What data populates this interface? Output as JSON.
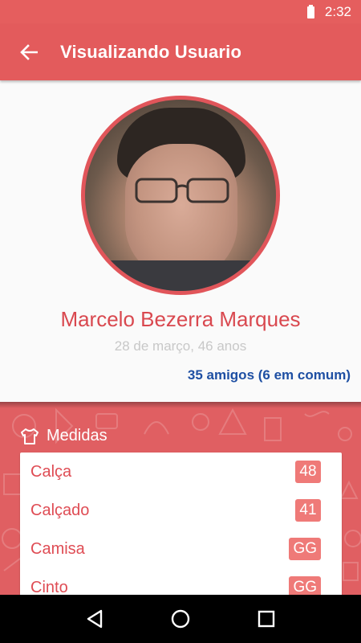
{
  "status_bar": {
    "time": "2:32",
    "battery_icon": "battery-icon"
  },
  "app_bar": {
    "title": "Visualizando Usuario",
    "back_icon": "arrow-back-icon",
    "color": "#e35b5c"
  },
  "profile": {
    "name": "Marcelo Bezerra Marques",
    "subtitle": "28 de março, 46 anos",
    "friends": "35 amigos (6 em comum)",
    "accent": "#d9484f",
    "link_color": "#1e4fa3"
  },
  "measures": {
    "title": "Medidas",
    "icon": "tshirt-icon",
    "items": [
      {
        "label": "Calça",
        "value": "48"
      },
      {
        "label": "Calçado",
        "value": "41"
      },
      {
        "label": "Camisa",
        "value": "GG"
      },
      {
        "label": "Cinto",
        "value": "GG"
      }
    ]
  },
  "nav_bar": {
    "icons": [
      "back-triangle-icon",
      "home-circle-icon",
      "recents-square-icon"
    ]
  }
}
